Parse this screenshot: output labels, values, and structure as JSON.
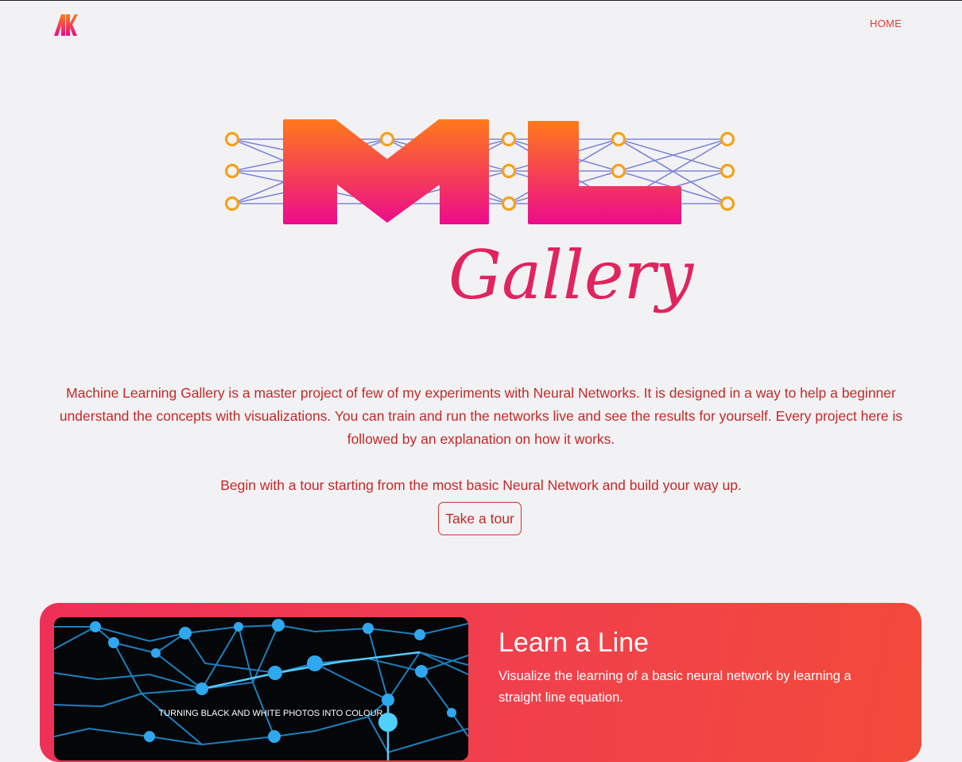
{
  "nav": {
    "home_label": "HOME"
  },
  "hero": {
    "logo_text_main": "ML",
    "logo_text_script": "Gallery"
  },
  "intro": {
    "paragraph1": "Machine Learning Gallery is a master project of few of my experiments with Neural Networks. It is designed in a way to help a beginner understand the concepts with visualizations. You can train and run the networks live and see the results for yourself. Every project here is followed by an explanation on how it works.",
    "paragraph2": "Begin with a tour starting from the most basic Neural Network and build your way up.",
    "tour_button": "Take a tour"
  },
  "projects": [
    {
      "title": "Learn a Line",
      "description": "Visualize the learning of a basic neural network by learning a straight line equation.",
      "image_caption": "TURNING BLACK AND WHITE PHOTOS INTO COLOUR"
    }
  ],
  "colors": {
    "accent_red": "#e53935",
    "text_red": "#c62828",
    "logo_orange": "#ff7a1a",
    "logo_pink": "#ec0b8c",
    "node_orange": "#f5a11a",
    "edge_blue": "#7f86d6",
    "card_gradient_start": "#ee3058",
    "card_gradient_end": "#f24a3a"
  }
}
